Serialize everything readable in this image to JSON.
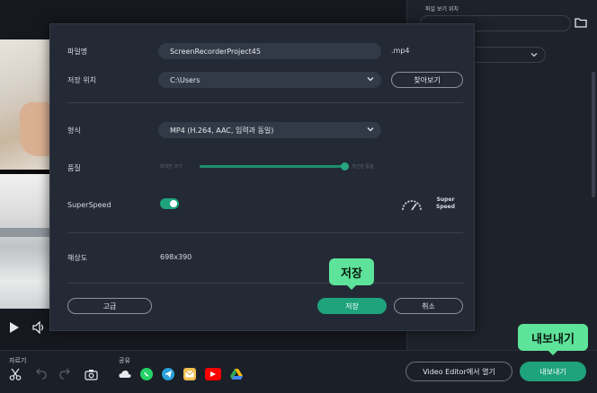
{
  "right_panel": {
    "folder_label": "파일 보기 위치"
  },
  "bottom": {
    "cut_label": "자르기",
    "share_label": "공유",
    "video_editor_button": "Video Editor에서 열기",
    "export_button": "내보내기",
    "share_icons": [
      {
        "name": "cloud-icon",
        "color": "#c8cdd6"
      },
      {
        "name": "whatsapp-icon",
        "color": "#25d366"
      },
      {
        "name": "telegram-icon",
        "color": "#2aa1da"
      },
      {
        "name": "email-icon",
        "color": "#f2c14e"
      },
      {
        "name": "youtube-icon",
        "color": "#ff0000"
      },
      {
        "name": "google-drive-icon",
        "color": "#34a853"
      }
    ]
  },
  "dialog": {
    "filename_label": "파일명",
    "filename_value": "ScreenRecorderProject45",
    "extension": ".mp4",
    "location_label": "저장 위치",
    "location_value": "C:\\Users",
    "browse_button": "찾아보기",
    "format_label": "형식",
    "format_value": "MP4 (H.264, AAC, 입력과 동일)",
    "quality_label": "품질",
    "quality_min": "최대한 크기",
    "quality_max": "개선된 품질",
    "quality_level": 0.97,
    "superspeed_label": "SuperSpeed",
    "superspeed_enabled": true,
    "superspeed_badge_line1": "Super",
    "superspeed_badge_line2": "Speed",
    "resolution_label": "해상도",
    "resolution_value": "698x390",
    "advanced_button": "고급",
    "save_button": "저장",
    "cancel_button": "취소"
  },
  "tooltips": {
    "save": "저장",
    "export": "내보내기"
  },
  "colors": {
    "accent": "#1ea37c",
    "tooltip": "#5ee39a",
    "dialog_bg": "#242a35",
    "app_bg": "#1b1f27"
  }
}
